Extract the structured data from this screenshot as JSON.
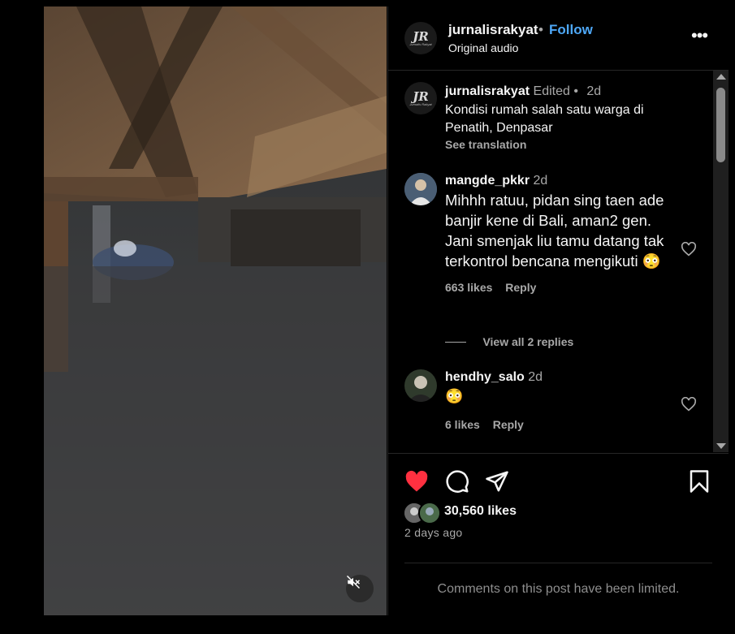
{
  "post": {
    "author": "jurnalisrakyat",
    "follow_label": "Follow",
    "separator": "•",
    "audio": "Original audio",
    "more_label": "•••",
    "avatar_initials": "JR",
    "avatar_subtitle": "Jurnalis Rakyat"
  },
  "caption": {
    "username": "jurnalisrakyat",
    "edited": "Edited",
    "dot": "•",
    "time": "2d",
    "text": "Kondisi rumah salah satu warga di Penatih, Denpasar",
    "see_translation": "See translation"
  },
  "comments": [
    {
      "username": "mangde_pkkr",
      "time": "2d",
      "text": "Mihhh ratuu, pidan sing taen ade banjir kene di Bali, aman2 gen. Jani smenjak liu tamu datang tak terkontrol bencana mengikuti 😳",
      "likes": "663 likes",
      "reply": "Reply",
      "view_replies": "View all 2 replies"
    },
    {
      "username": "hendhy_salo",
      "time": "2d",
      "text": "😳",
      "likes": "6 likes",
      "reply": "Reply"
    }
  ],
  "actions": {
    "likes_count": "30,560 likes",
    "posted_ago": "2 days ago",
    "comments_limited": "Comments on this post have been limited."
  },
  "colors": {
    "liked_heart": "#ff3040",
    "follow": "#4ea8f7",
    "background": "#000000",
    "border": "#262626"
  },
  "icons": [
    "mute-icon",
    "more-icon",
    "heart-icon",
    "comment-icon",
    "share-icon",
    "bookmark-icon",
    "scroll-up-arrow",
    "scroll-down-arrow"
  ]
}
